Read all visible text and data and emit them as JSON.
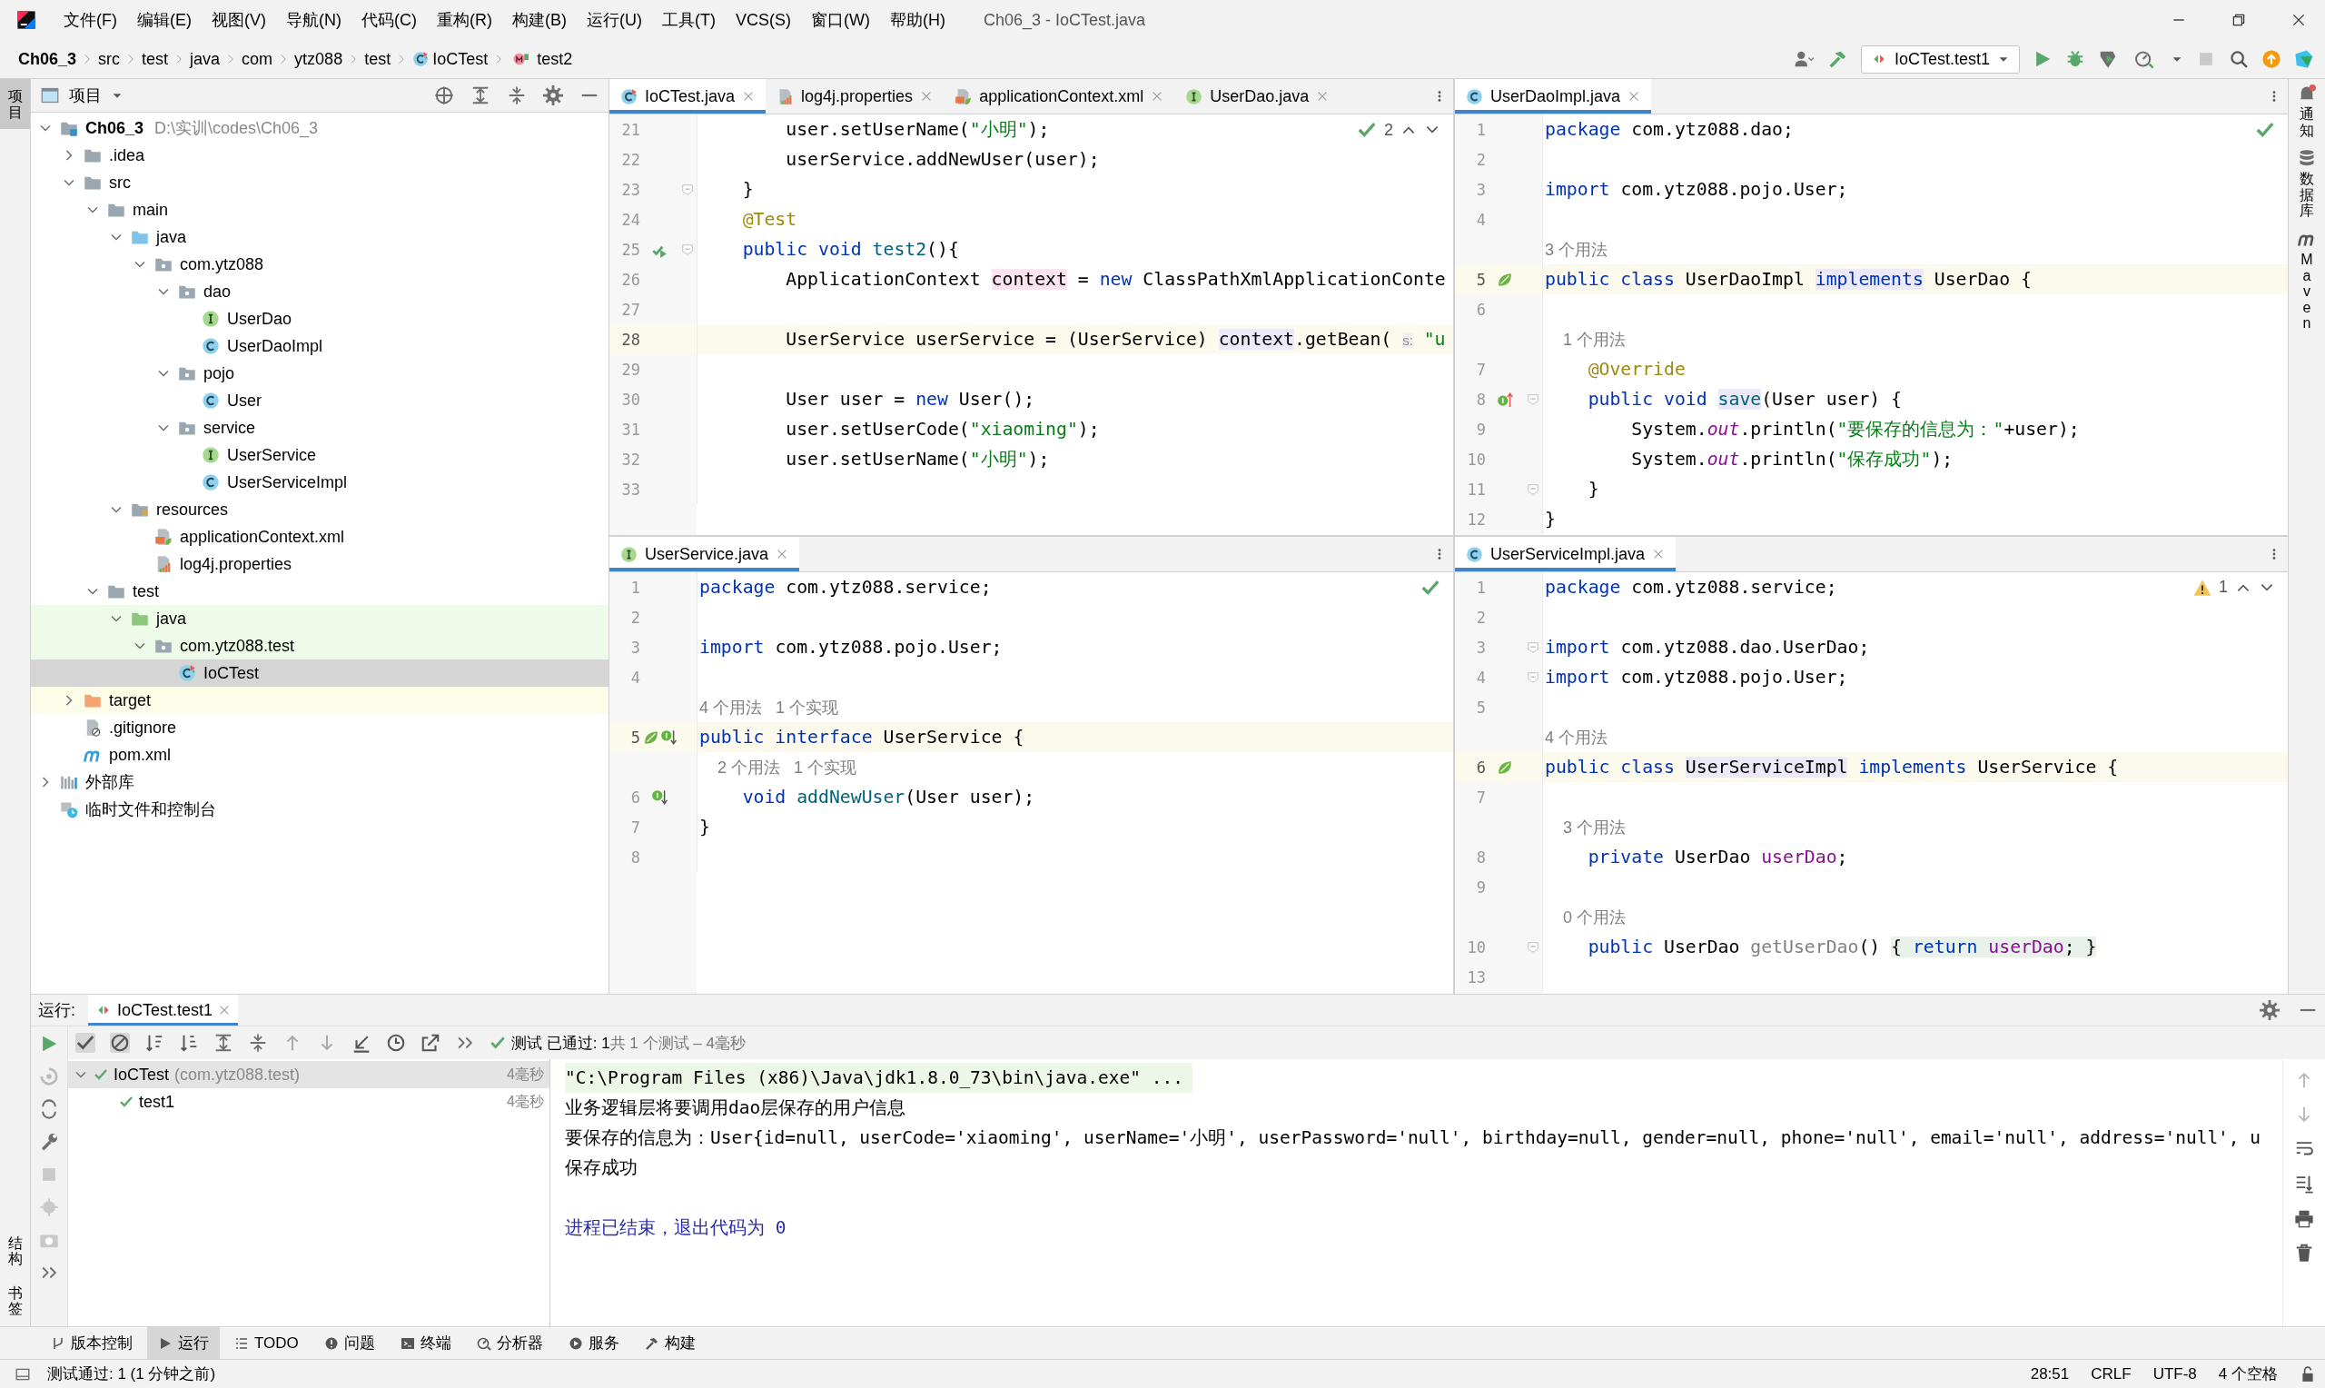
{
  "menu": [
    "文件(F)",
    "编辑(E)",
    "视图(V)",
    "导航(N)",
    "代码(C)",
    "重构(R)",
    "构建(B)",
    "运行(U)",
    "工具(T)",
    "VCS(S)",
    "窗口(W)",
    "帮助(H)"
  ],
  "window": {
    "title": "Ch06_3 - IoCTest.java"
  },
  "breadcrumbs": [
    {
      "label": "Ch06_3",
      "kind": "module"
    },
    {
      "label": "src",
      "kind": "plain"
    },
    {
      "label": "test",
      "kind": "plain"
    },
    {
      "label": "java",
      "kind": "plain"
    },
    {
      "label": "com",
      "kind": "plain"
    },
    {
      "label": "ytz088",
      "kind": "plain"
    },
    {
      "label": "test",
      "kind": "plain"
    },
    {
      "label": "IoCTest",
      "kind": "class"
    },
    {
      "label": "test2",
      "kind": "method"
    }
  ],
  "run_config": {
    "label": "IoCTest.test1"
  },
  "left_strip": [
    {
      "label": "项目",
      "selected": true,
      "kind": "top"
    },
    {
      "label": "结构",
      "selected": false,
      "kind": "bottom"
    },
    {
      "label": "书签",
      "selected": false,
      "kind": "bottom"
    }
  ],
  "right_strip": [
    {
      "label": "通知",
      "kind": "bell"
    },
    {
      "label": "数据库",
      "kind": "database"
    },
    {
      "label": "Maven",
      "kind": "maven"
    }
  ],
  "project": {
    "title": "项目",
    "tree": [
      {
        "label": "Ch06_3",
        "path": "D:\\实训\\codes\\Ch06_3",
        "kind": "module",
        "expanded": true,
        "selected": false,
        "children": [
          {
            "label": ".idea",
            "kind": "folder",
            "expanded": false,
            "selected": false
          },
          {
            "label": "src",
            "kind": "folder",
            "expanded": true,
            "selected": false,
            "children": [
              {
                "label": "main",
                "kind": "folder",
                "expanded": true,
                "selected": false,
                "children": [
                  {
                    "label": "java",
                    "kind": "source",
                    "expanded": true,
                    "selected": false,
                    "children": [
                      {
                        "label": "com.ytz088",
                        "kind": "package",
                        "expanded": true,
                        "selected": false,
                        "children": [
                          {
                            "label": "dao",
                            "kind": "package",
                            "expanded": true,
                            "selected": false,
                            "children": [
                              {
                                "label": "UserDao",
                                "kind": "interface",
                                "selected": false
                              },
                              {
                                "label": "UserDaoImpl",
                                "kind": "class",
                                "selected": false
                              }
                            ]
                          },
                          {
                            "label": "pojo",
                            "kind": "package",
                            "expanded": true,
                            "selected": false,
                            "children": [
                              {
                                "label": "User",
                                "kind": "class",
                                "selected": false
                              }
                            ]
                          },
                          {
                            "label": "service",
                            "kind": "package",
                            "expanded": true,
                            "selected": false,
                            "children": [
                              {
                                "label": "UserService",
                                "kind": "interface",
                                "selected": false
                              },
                              {
                                "label": "UserServiceImpl",
                                "kind": "class",
                                "selected": false
                              }
                            ]
                          }
                        ]
                      }
                    ]
                  },
                  {
                    "label": "resources",
                    "kind": "resources",
                    "expanded": true,
                    "selected": false,
                    "children": [
                      {
                        "label": "applicationContext.xml",
                        "kind": "xml",
                        "selected": false
                      },
                      {
                        "label": "log4j.properties",
                        "kind": "properties",
                        "selected": false
                      }
                    ]
                  }
                ]
              },
              {
                "label": "test",
                "kind": "folder",
                "expanded": true,
                "selected": false,
                "children": [
                  {
                    "label": "java",
                    "kind": "test-source",
                    "expanded": true,
                    "selected": false,
                    "children": [
                      {
                        "label": "com.ytz088.test",
                        "kind": "test-package",
                        "expanded": true,
                        "selected": false,
                        "children": [
                          {
                            "label": "IoCTest",
                            "kind": "test-class",
                            "selected": true
                          }
                        ]
                      }
                    ]
                  }
                ]
              }
            ]
          },
          {
            "label": "target",
            "kind": "excluded",
            "expanded": false,
            "selected": false
          },
          {
            "label": ".gitignore",
            "kind": "gitignore",
            "selected": false
          },
          {
            "label": "pom.xml",
            "kind": "maven",
            "selected": false
          }
        ]
      },
      {
        "label": "外部库",
        "kind": "libraries",
        "expanded": false,
        "selected": false
      },
      {
        "label": "临时文件和控制台",
        "kind": "scratches",
        "selected": false
      }
    ]
  },
  "editors": [
    {
      "tabs": [
        {
          "label": "IoCTest.java",
          "kind": "test-class",
          "selected": true
        },
        {
          "label": "log4j.properties",
          "kind": "properties",
          "selected": false
        },
        {
          "label": "applicationContext.xml",
          "kind": "xml",
          "selected": false
        },
        {
          "label": "UserDao.java",
          "kind": "interface",
          "selected": false
        }
      ],
      "inspection": {
        "kind": "ok",
        "count": "2"
      },
      "lines": [
        {
          "no": "21",
          "tokens": [
            {
              "kind": "plain",
              "text": "        user.setUserName("
            },
            {
              "kind": "str",
              "text": "\"小明\""
            },
            {
              "kind": "plain",
              "text": ");"
            }
          ]
        },
        {
          "no": "22",
          "tokens": [
            {
              "kind": "plain",
              "text": "        userService.addNewUser(user);"
            }
          ]
        },
        {
          "no": "23",
          "fold": true,
          "tokens": [
            {
              "kind": "plain",
              "text": "    }"
            }
          ]
        },
        {
          "no": "24",
          "tokens": [
            {
              "kind": "ann",
              "text": "    @Test"
            }
          ]
        },
        {
          "no": "25",
          "gutter": [
            {
              "kind": "run"
            }
          ],
          "fold": true,
          "tokens": [
            {
              "kind": "kw",
              "text": "    public void "
            },
            {
              "kind": "decl",
              "text": "test2"
            },
            {
              "kind": "plain",
              "text": "(){"
            }
          ]
        },
        {
          "no": "26",
          "tokens": [
            {
              "kind": "plain",
              "text": "        ApplicationContext "
            },
            {
              "kind": "write",
              "text": "context"
            },
            {
              "kind": "plain",
              "text": " = "
            },
            {
              "kind": "kw",
              "text": "new"
            },
            {
              "kind": "plain",
              "text": " ClassPathXmlApplicationConte"
            }
          ]
        },
        {
          "no": "27"
        },
        {
          "no": "28",
          "current": true,
          "tokens": [
            {
              "kind": "plain",
              "text": "        UserService userService = (UserService) "
            },
            {
              "kind": "read",
              "text": "context"
            },
            {
              "kind": "plain",
              "text": ".getBean( "
            },
            {
              "kind": "param",
              "text": "s:"
            },
            {
              "kind": "str",
              "text": " \"u"
            }
          ]
        },
        {
          "no": "29"
        },
        {
          "no": "30",
          "tokens": [
            {
              "kind": "plain",
              "text": "        User user = "
            },
            {
              "kind": "kw",
              "text": "new"
            },
            {
              "kind": "plain",
              "text": " User();"
            }
          ]
        },
        {
          "no": "31",
          "tokens": [
            {
              "kind": "plain",
              "text": "        user.setUserCode("
            },
            {
              "kind": "str",
              "text": "\"xiaoming\""
            },
            {
              "kind": "plain",
              "text": ");"
            }
          ]
        },
        {
          "no": "32",
          "tokens": [
            {
              "kind": "plain",
              "text": "        user.setUserName("
            },
            {
              "kind": "str",
              "text": "\"小明\""
            },
            {
              "kind": "plain",
              "text": ");"
            }
          ]
        },
        {
          "no": "33"
        }
      ]
    },
    {
      "tabs": [
        {
          "label": "UserDaoImpl.java",
          "kind": "class",
          "selected": true
        }
      ],
      "inspection": {
        "kind": "ok"
      },
      "lines": [
        {
          "no": "1",
          "tokens": [
            {
              "kind": "kw",
              "text": "package"
            },
            {
              "kind": "plain",
              "text": " com.ytz088.dao;"
            }
          ]
        },
        {
          "no": "2"
        },
        {
          "no": "3",
          "tokens": [
            {
              "kind": "kw",
              "text": "import"
            },
            {
              "kind": "plain",
              "text": " com.ytz088.pojo.User;"
            }
          ]
        },
        {
          "no": "4"
        },
        {
          "tokens": [
            {
              "kind": "hint",
              "text": "3 个用法"
            }
          ]
        },
        {
          "no": "5",
          "current": true,
          "gutter": [
            {
              "kind": "bean"
            }
          ],
          "tokens": [
            {
              "kind": "kw",
              "text": "public class"
            },
            {
              "kind": "plain",
              "text": " UserDaoImpl "
            },
            {
              "kind": "kw-read",
              "text": "implements"
            },
            {
              "kind": "plain",
              "text": " UserDao {"
            }
          ]
        },
        {
          "no": "6"
        },
        {
          "tokens": [
            {
              "kind": "hint",
              "text": "    1 个用法"
            }
          ]
        },
        {
          "no": "7",
          "tokens": [
            {
              "kind": "ann",
              "text": "    @Override"
            }
          ]
        },
        {
          "no": "8",
          "gutter": [
            {
              "kind": "override"
            }
          ],
          "fold": true,
          "tokens": [
            {
              "kind": "kw",
              "text": "    public void "
            },
            {
              "kind": "decl-read",
              "text": "save"
            },
            {
              "kind": "plain",
              "text": "(User user) {"
            }
          ]
        },
        {
          "no": "9",
          "tokens": [
            {
              "kind": "plain",
              "text": "        System."
            },
            {
              "kind": "static",
              "text": "out"
            },
            {
              "kind": "plain",
              "text": ".println("
            },
            {
              "kind": "str",
              "text": "\"要保存的信息为：\""
            },
            {
              "kind": "plain",
              "text": "+user);"
            }
          ]
        },
        {
          "no": "10",
          "tokens": [
            {
              "kind": "plain",
              "text": "        System."
            },
            {
              "kind": "static",
              "text": "out"
            },
            {
              "kind": "plain",
              "text": ".println("
            },
            {
              "kind": "str",
              "text": "\"保存成功\""
            },
            {
              "kind": "plain",
              "text": ");"
            }
          ]
        },
        {
          "no": "11",
          "fold": true,
          "tokens": [
            {
              "kind": "plain",
              "text": "    }"
            }
          ]
        },
        {
          "no": "12",
          "tokens": [
            {
              "kind": "plain",
              "text": "}"
            }
          ]
        }
      ]
    },
    {
      "tabs": [
        {
          "label": "UserService.java",
          "kind": "interface",
          "selected": true
        }
      ],
      "inspection": {
        "kind": "ok"
      },
      "lines": [
        {
          "no": "1",
          "tokens": [
            {
              "kind": "kw",
              "text": "package"
            },
            {
              "kind": "plain",
              "text": " com.ytz088.service;"
            }
          ]
        },
        {
          "no": "2"
        },
        {
          "no": "3",
          "tokens": [
            {
              "kind": "kw",
              "text": "import"
            },
            {
              "kind": "plain",
              "text": " com.ytz088.pojo.User;"
            }
          ]
        },
        {
          "no": "4"
        },
        {
          "tokens": [
            {
              "kind": "hint",
              "text": "4 个用法   1 个实现"
            }
          ]
        },
        {
          "no": "5",
          "current": true,
          "gutter": [
            {
              "kind": "bean"
            },
            {
              "kind": "implemented"
            }
          ],
          "tokens": [
            {
              "kind": "kw",
              "text": "public interface"
            },
            {
              "kind": "plain",
              "text": " UserService {"
            }
          ]
        },
        {
          "tokens": [
            {
              "kind": "hint",
              "text": "    2 个用法   1 个实现"
            }
          ]
        },
        {
          "no": "6",
          "gutter": [
            {
              "kind": "implemented"
            }
          ],
          "tokens": [
            {
              "kind": "kw",
              "text": "    void "
            },
            {
              "kind": "decl",
              "text": "addNewUser"
            },
            {
              "kind": "plain",
              "text": "(User user);"
            }
          ]
        },
        {
          "no": "7",
          "tokens": [
            {
              "kind": "plain",
              "text": "}"
            }
          ]
        },
        {
          "no": "8"
        }
      ]
    },
    {
      "tabs": [
        {
          "label": "UserServiceImpl.java",
          "kind": "class",
          "selected": true
        }
      ],
      "inspection": {
        "kind": "warning",
        "count": "1"
      },
      "lines": [
        {
          "no": "1",
          "tokens": [
            {
              "kind": "kw",
              "text": "package"
            },
            {
              "kind": "plain",
              "text": " com.ytz088.service;"
            }
          ]
        },
        {
          "no": "2"
        },
        {
          "no": "3",
          "fold": true,
          "tokens": [
            {
              "kind": "kw",
              "text": "import"
            },
            {
              "kind": "plain",
              "text": " com.ytz088.dao.UserDao;"
            }
          ]
        },
        {
          "no": "4",
          "fold": true,
          "tokens": [
            {
              "kind": "kw",
              "text": "import"
            },
            {
              "kind": "plain",
              "text": " com.ytz088.pojo.User;"
            }
          ]
        },
        {
          "no": "5"
        },
        {
          "tokens": [
            {
              "kind": "hint",
              "text": "4 个用法"
            }
          ]
        },
        {
          "no": "6",
          "current": true,
          "gutter": [
            {
              "kind": "bean"
            }
          ],
          "tokens": [
            {
              "kind": "kw",
              "text": "public class "
            },
            {
              "kind": "read",
              "text": "UserServiceImpl"
            },
            {
              "kind": "kw",
              "text": " implements"
            },
            {
              "kind": "plain",
              "text": " UserService {"
            }
          ]
        },
        {
          "no": "7"
        },
        {
          "tokens": [
            {
              "kind": "hint",
              "text": "    3 个用法"
            }
          ]
        },
        {
          "no": "8",
          "tokens": [
            {
              "kind": "kw",
              "text": "    private"
            },
            {
              "kind": "plain",
              "text": " UserDao "
            },
            {
              "kind": "field",
              "text": "userDao"
            },
            {
              "kind": "plain",
              "text": ";"
            }
          ]
        },
        {
          "no": "9"
        },
        {
          "tokens": [
            {
              "kind": "hint",
              "text": "    0 个用法"
            }
          ]
        },
        {
          "no": "10",
          "fold": true,
          "tokens": [
            {
              "kind": "kw",
              "text": "    public"
            },
            {
              "kind": "plain",
              "text": " UserDao "
            },
            {
              "kind": "unused",
              "text": "getUserDao"
            },
            {
              "kind": "plain",
              "text": "() "
            },
            {
              "kind": "folded",
              "text": "{ "
            },
            {
              "kind": "kw-folded",
              "text": "return "
            },
            {
              "kind": "field-folded",
              "text": "userDao"
            },
            {
              "kind": "folded",
              "text": "; }"
            }
          ]
        },
        {
          "no": "13"
        }
      ]
    }
  ],
  "run": {
    "label": "运行:",
    "tab": "IoCTest.test1",
    "status": "测试 已通过: 1",
    "summary": "共 1 个测试 – 4毫秒",
    "tests": [
      {
        "label": "IoCTest",
        "detail": "(com.ytz088.test)",
        "time": "4毫秒",
        "passed": true,
        "expanded": true,
        "selected": true,
        "children": [
          {
            "label": "test1",
            "time": "4毫秒",
            "passed": true,
            "selected": false
          }
        ]
      }
    ],
    "console": [
      {
        "kind": "command",
        "text": "\"C:\\Program Files (x86)\\Java\\jdk1.8.0_73\\bin\\java.exe\" ..."
      },
      {
        "kind": "output",
        "text": "业务逻辑层将要调用dao层保存的用户信息"
      },
      {
        "kind": "output",
        "text": "要保存的信息为：User{id=null, userCode='xiaoming', userName='小明', userPassword='null', birthday=null, gender=null, phone='null', email='null', address='null', u"
      },
      {
        "kind": "output",
        "text": "保存成功"
      },
      {
        "kind": "blank"
      },
      {
        "kind": "system",
        "text": "进程已结束，退出代码为 0"
      }
    ]
  },
  "tool_windows": [
    {
      "label": "版本控制",
      "kind": "branch",
      "selected": false
    },
    {
      "label": "运行",
      "kind": "play",
      "selected": true
    },
    {
      "label": "TODO",
      "kind": "list",
      "selected": false
    },
    {
      "label": "问题",
      "kind": "problem",
      "selected": false
    },
    {
      "label": "终端",
      "kind": "terminal",
      "selected": false
    },
    {
      "label": "分析器",
      "kind": "profiler",
      "selected": false
    },
    {
      "label": "服务",
      "kind": "services",
      "selected": false
    },
    {
      "label": "构建",
      "kind": "hammer",
      "selected": false
    }
  ],
  "status_bar": {
    "message": "测试通过: 1 (1 分钟之前)",
    "items": [
      "28:51",
      "CRLF",
      "UTF-8",
      "4 个空格"
    ]
  }
}
